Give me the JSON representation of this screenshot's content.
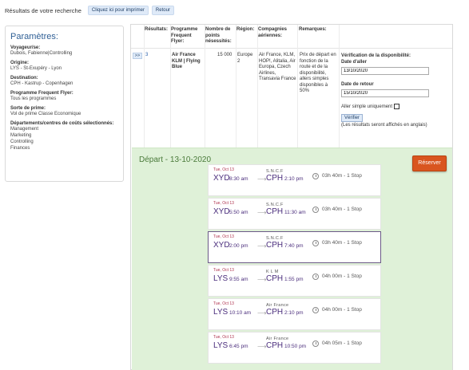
{
  "header": {
    "title": "Résultats de votre recherche",
    "print_label": "Cliquez ici pour imprimer",
    "back_label": "Retour"
  },
  "sidebar": {
    "title": "Paramètres:",
    "sections": [
      {
        "label": "Voyageur/se:",
        "lines": [
          "Dubois, Fabienne|Controlling"
        ]
      },
      {
        "label": "Origine:",
        "lines": [
          "LYS - St-Exupéry - Lyon"
        ]
      },
      {
        "label": "Destination:",
        "lines": [
          "CPH - Kastrup - Copenhagen"
        ]
      },
      {
        "label": "Programme Frequent Flyer:",
        "lines": [
          "Tous les programmes"
        ]
      },
      {
        "label": "Sorte de prime:",
        "lines": [
          "Vol de prime Classe Economique"
        ]
      },
      {
        "label": "Départements/centres de coûts sélectionnés:",
        "lines": [
          "Management",
          "Marketing",
          "Controlling",
          "Finances"
        ]
      }
    ]
  },
  "table": {
    "headers": {
      "results": "Résultats:",
      "program": "Programme Frequent Flyer:",
      "points": "Nombre de points nésessités:",
      "region": "Région:",
      "airlines": "Compagnies aériennes:",
      "remarks": "Remarques:"
    },
    "row": {
      "expand_label": ">>",
      "results": "3",
      "program": "Air France KLM | Flying Blue",
      "points": "15 000",
      "region": "Europe 2",
      "airlines": "Air France, KLM, HOP!, Alitalia, Air Europa, Czech Airlines, Transavia France",
      "remarks": "Prix de départ en fonction de la route et de la disponibilité, allers simples disponibles à 50%"
    }
  },
  "availability": {
    "title": "Vérification de la disponibilité:",
    "depart_label": "Date d'aller",
    "depart_value": "13/10/2020",
    "return_label": "Date de retour",
    "return_value": "15/10/2020",
    "oneway_label": "Aller simple uniquement",
    "verify_label": "Vérifier",
    "note": "(Les résultats seront affichés en anglais)"
  },
  "results": {
    "title": "Départ - 13-10-2020",
    "reserve_label": "Réserver",
    "flights": [
      {
        "date": "Tue, Oct 13",
        "origin": "XYD",
        "otime": "8:30 am",
        "carrier": "S.N.C.F",
        "dest": "CPH",
        "dtime": "2:10 pm",
        "duration": "03h 40m - 1 Stop"
      },
      {
        "date": "Tue, Oct 13",
        "origin": "XYD",
        "otime": "5:50 am",
        "carrier": "S.N.C.F",
        "dest": "CPH",
        "dtime": "11:30 am",
        "duration": "03h 40m - 1 Stop"
      },
      {
        "date": "Tue, Oct 13",
        "origin": "XYD",
        "otime": "2:00 pm",
        "carrier": "S.N.C.F",
        "dest": "CPH",
        "dtime": "7:40 pm",
        "duration": "03h 40m - 1 Stop",
        "selected": true
      },
      {
        "date": "Tue, Oct 13",
        "origin": "LYS",
        "otime": "9:55 am",
        "carrier": "K L M",
        "dest": "CPH",
        "dtime": "1:55 pm",
        "duration": "04h 00m - 1 Stop"
      },
      {
        "date": "Tue, Oct 13",
        "origin": "LYS",
        "otime": "10:10 am",
        "carrier": "Air France",
        "dest": "CPH",
        "dtime": "2:10 pm",
        "duration": "04h 00m - 1 Stop"
      },
      {
        "date": "Tue, Oct 13",
        "origin": "LYS",
        "otime": "6:45 pm",
        "carrier": "Air France",
        "dest": "CPH",
        "dtime": "10:50 pm",
        "duration": "04h 05m - 1 Stop"
      }
    ]
  }
}
